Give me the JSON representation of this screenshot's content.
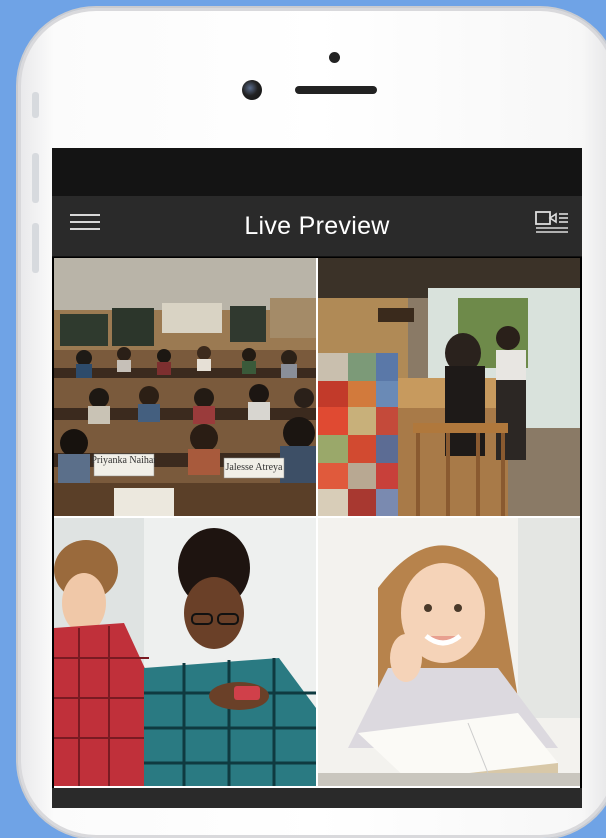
{
  "header": {
    "title": "Live Preview"
  },
  "icons": {
    "menu": "hamburger-menu-icon",
    "camera_list": "camera-list-icon"
  },
  "colors": {
    "background": "#6fa3e6",
    "header": "#2a2a2a",
    "status_bar": "#141414"
  },
  "feeds": [
    {
      "scene": "lecture-hall",
      "nameplates": [
        "Priyanka Naihar",
        "Jalesse Atreya"
      ]
    },
    {
      "scene": "cafe"
    },
    {
      "scene": "students-with-phone"
    },
    {
      "scene": "girl-reading"
    }
  ]
}
